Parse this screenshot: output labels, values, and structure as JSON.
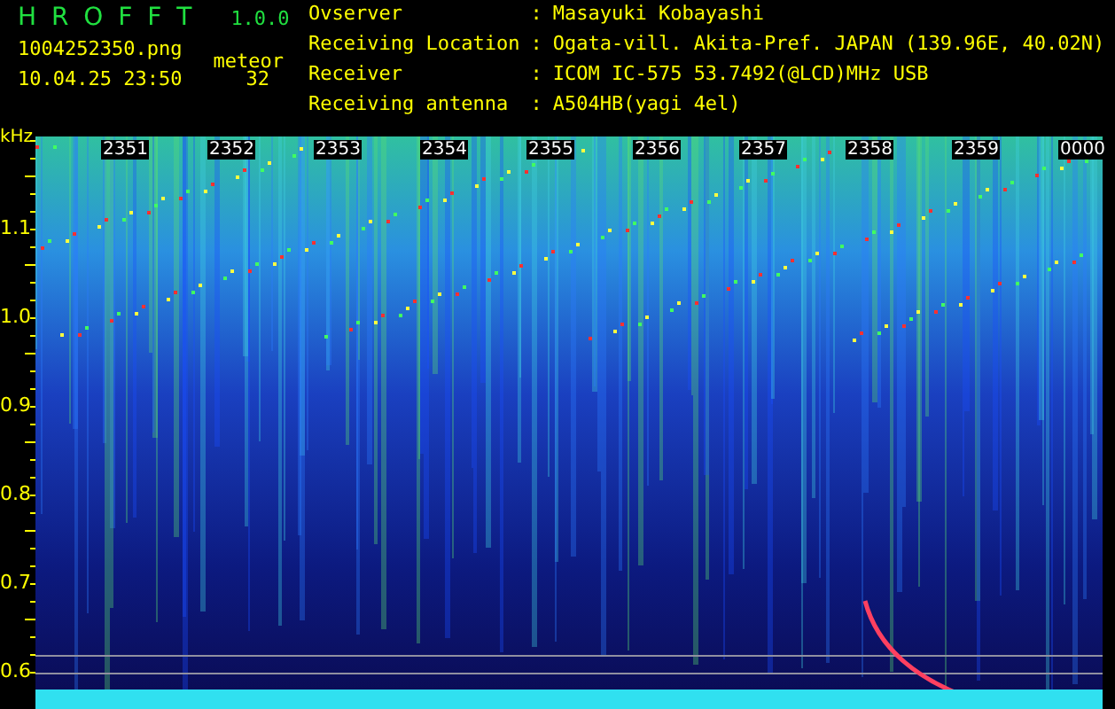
{
  "app": {
    "name": "H R O F F T",
    "version": "1.0.0"
  },
  "file": "1004252350.png",
  "datetime": "10.04.25 23:50",
  "meteor": {
    "label": "meteor",
    "count": "32"
  },
  "info": [
    {
      "label": "Ovserver",
      "separator": ":",
      "value": "Masayuki Kobayashi"
    },
    {
      "label": "Receiving Location",
      "separator": ":",
      "value": "Ogata-vill. Akita-Pref. JAPAN (139.96E, 40.02N)"
    },
    {
      "label": "Receiver",
      "separator": ":",
      "value": "ICOM IC-575 53.7492(@LCD)MHz USB"
    },
    {
      "label": "Receiving antenna",
      "separator": ":",
      "value": "A504HB(yagi 4el)"
    }
  ],
  "axis_unit": "kHz",
  "y_labels": [
    "1.1",
    "1.0",
    "0.9",
    "0.8",
    "0.7",
    "0.6"
  ],
  "time_labels": [
    "2351",
    "2352",
    "2353",
    "2354",
    "2355",
    "2356",
    "2357",
    "2358",
    "2359",
    "0000"
  ]
}
